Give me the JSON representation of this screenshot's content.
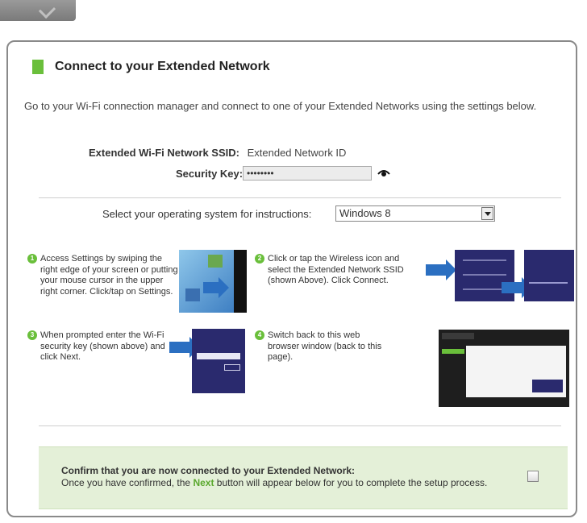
{
  "heading": "Connect to your Extended Network",
  "intro": "Go to your Wi-Fi connection manager and connect to one of your Extended Networks using the settings below.",
  "ssid": {
    "label": "Extended Wi-Fi Network SSID:",
    "value": "Extended Network ID"
  },
  "security": {
    "label": "Security Key:",
    "value": "••••••••"
  },
  "os": {
    "label": "Select your operating system for instructions:",
    "selected": "Windows 8"
  },
  "steps": [
    {
      "num": "1",
      "text": "Access Settings by swiping the right edge of your screen or putting your mouse cursor in the upper right corner. Click/tap on Settings."
    },
    {
      "num": "2",
      "text": "Click or tap the Wireless icon and select the Extended Network SSID (shown Above). Click Connect."
    },
    {
      "num": "3",
      "text": "When prompted enter the Wi-Fi security key (shown above) and click Next."
    },
    {
      "num": "4",
      "text": "Switch back to this web browser window (back to this page)."
    }
  ],
  "confirm": {
    "title": "Confirm that you are now connected to your Extended Network:",
    "pre": "Once you have confirmed, the ",
    "next": "Next",
    "post": " button will appear below for you to complete the setup process."
  },
  "colors": {
    "accent": "#6abf3b",
    "confirm_bg": "#e4f0d8",
    "arrow": "#2b6fc1",
    "win8": "#2a2a6e"
  }
}
